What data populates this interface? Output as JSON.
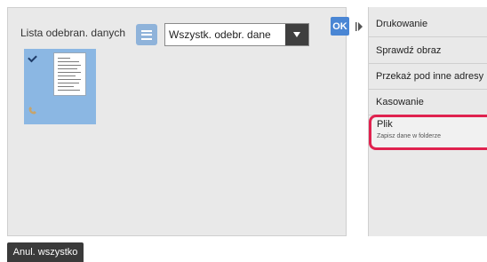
{
  "list": {
    "title": "Lista odebran. danych",
    "filter_value": "Wszystk. odebr. dane",
    "ok_label": "OK"
  },
  "footer": {
    "cancel_all_label": "Anul. wszystko"
  },
  "side_menu": {
    "items": [
      {
        "label": "Drukowanie"
      },
      {
        "label": "Sprawdź obraz"
      },
      {
        "label": "Przekaż pod inne adresy"
      },
      {
        "label": "Kasowanie"
      },
      {
        "label": "Plik",
        "sublabel": "Zapisz dane w folderze",
        "selected": true
      }
    ]
  },
  "colors": {
    "highlight": "#e0224f",
    "thumbnail_bg": "#8bb7e3",
    "ok_button": "#4a86d4"
  },
  "icons": [
    "list-view-icon",
    "chevron-down-icon",
    "checkmark-icon",
    "document-thumbnail",
    "fax-icon",
    "panel-toggle-icon"
  ]
}
